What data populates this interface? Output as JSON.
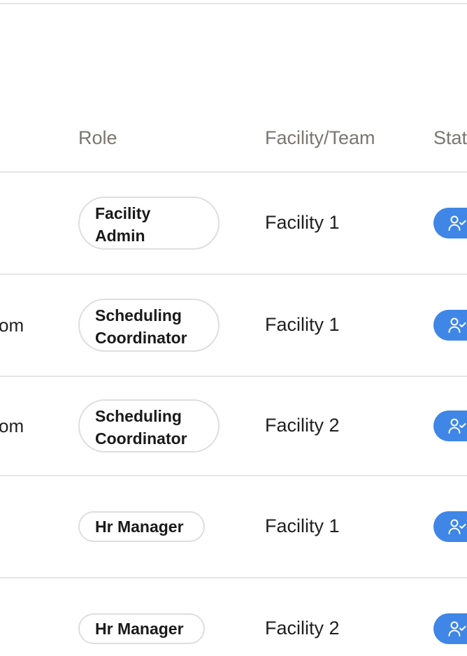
{
  "table": {
    "headers": {
      "role": "Role",
      "facility": "Facility/Team",
      "status": "Stat"
    },
    "rows": [
      {
        "email_fragment": "",
        "role": "Facility Admin",
        "facility": "Facility 1",
        "status_icon": "user-check-icon"
      },
      {
        "email_fragment": "om",
        "role": "Scheduling Coordinator",
        "facility": "Facility 1",
        "status_icon": "user-check-icon"
      },
      {
        "email_fragment": "om",
        "role": "Scheduling Coordinator",
        "facility": "Facility 2",
        "status_icon": "user-check-icon"
      },
      {
        "email_fragment": "",
        "role": "Hr Manager",
        "facility": "Facility 1",
        "status_icon": "user-check-icon"
      },
      {
        "email_fragment": "",
        "role": "Hr Manager",
        "facility": "Facility 2",
        "status_icon": "user-check-icon"
      }
    ]
  },
  "colors": {
    "status_active": "#3f86e6",
    "header_text": "#7a7670",
    "divider": "#e6e6e6"
  }
}
